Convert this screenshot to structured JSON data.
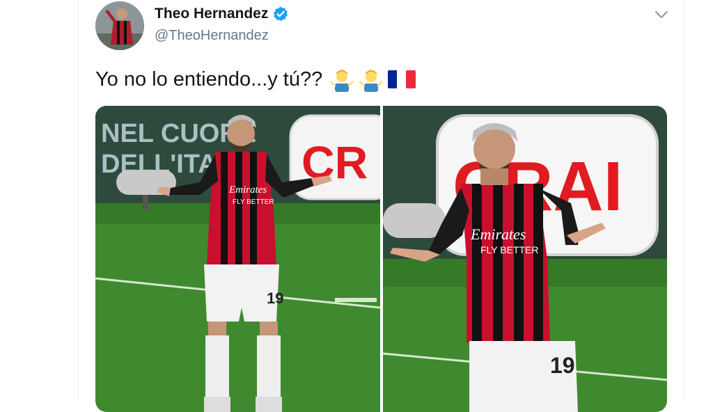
{
  "tweet": {
    "author": {
      "name": "Theo Hernandez",
      "handle": "@TheoHernandez",
      "verified": true
    },
    "text": "Yo no lo entiendo...y tú??",
    "emojis": [
      "man-shrugging-emoji",
      "man-shrugging-emoji",
      "france-flag-emoji"
    ],
    "media": [
      {
        "description_icon": "photo-player-shrugging-left",
        "ad_board_text": [
          "NEL CUORE",
          "DELL'ITA"
        ],
        "sponsor_logo": "CR"
      },
      {
        "description_icon": "photo-player-shrugging-right",
        "ad_board_text": [],
        "sponsor_logo": "CRAI"
      }
    ],
    "shirt": {
      "sponsor": "Emirates",
      "slogan": "FLY BETTER",
      "number": "19"
    }
  },
  "colors": {
    "verified_badge": "#1da1f2",
    "milan_red": "#c8102e",
    "pitch_green": "#3f8a2e",
    "board_green": "#2e4a3c"
  }
}
